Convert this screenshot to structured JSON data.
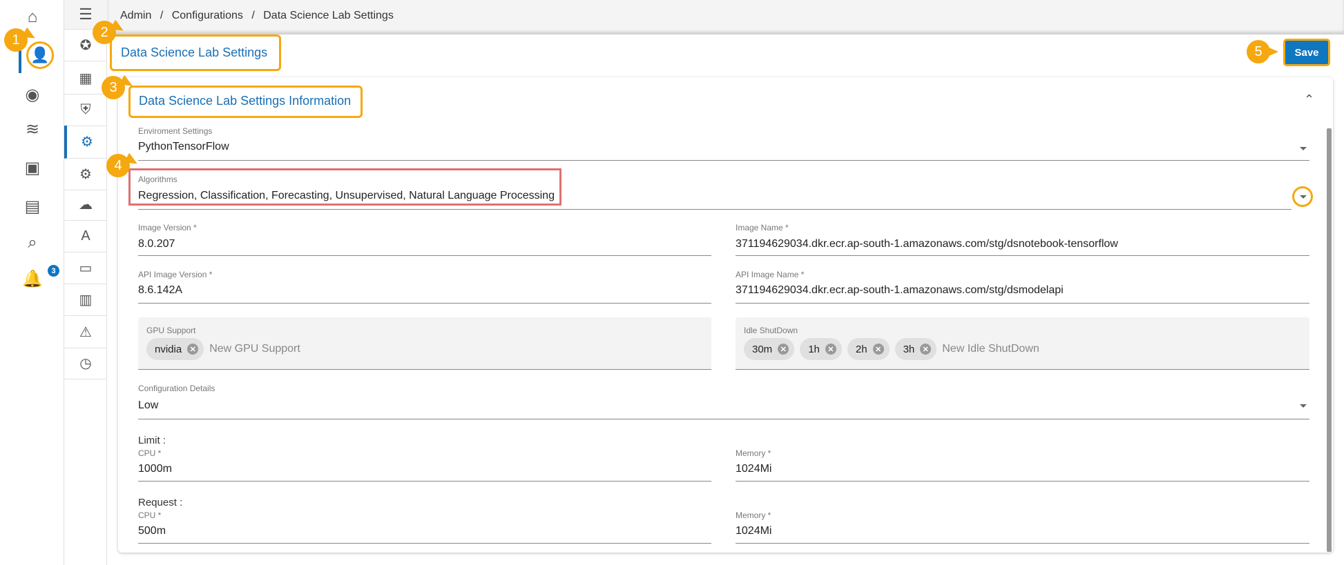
{
  "breadcrumb": {
    "items": [
      "Admin",
      "Configurations",
      "Data Science Lab Settings"
    ],
    "separator": "/"
  },
  "page_title": "Data Science Lab Settings",
  "save_label": "Save",
  "card_title": "Data Science Lab Settings Information",
  "notifications_count": "3",
  "accent": "#0f76c0",
  "callout_color": "#f5a80f",
  "callouts": [
    "1",
    "2",
    "3",
    "4",
    "5"
  ],
  "form": {
    "environment": {
      "label": "Enviroment Settings",
      "value": "PythonTensorFlow"
    },
    "algorithms": {
      "label": "Algorithms",
      "value": "Regression, Classification, Forecasting, Unsupervised, Natural Language Processing"
    },
    "image_version": {
      "label": "Image Version *",
      "value": "8.0.207"
    },
    "image_name": {
      "label": "Image Name *",
      "value": "371194629034.dkr.ecr.ap-south-1.amazonaws.com/stg/dsnotebook-tensorflow"
    },
    "api_image_version": {
      "label": "API Image Version *",
      "value": "8.6.142A"
    },
    "api_image_name": {
      "label": "API Image Name *",
      "value": "371194629034.dkr.ecr.ap-south-1.amazonaws.com/stg/dsmodelapi"
    },
    "gpu_support": {
      "label": "GPU Support",
      "chips": [
        "nvidia"
      ],
      "placeholder": "New GPU Support"
    },
    "idle_shutdown": {
      "label": "Idle ShutDown",
      "chips": [
        "30m",
        "1h",
        "2h",
        "3h"
      ],
      "placeholder": "New Idle ShutDown"
    },
    "configuration_details": {
      "label": "Configuration Details",
      "value": "Low"
    },
    "limit": {
      "heading": "Limit :",
      "cpu_label": "CPU *",
      "cpu": "1000m",
      "memory_label": "Memory *",
      "memory": "1024Mi"
    },
    "request": {
      "heading": "Request :",
      "cpu_label": "CPU *",
      "cpu": "500m",
      "memory_label": "Memory *",
      "memory": "1024Mi"
    }
  }
}
